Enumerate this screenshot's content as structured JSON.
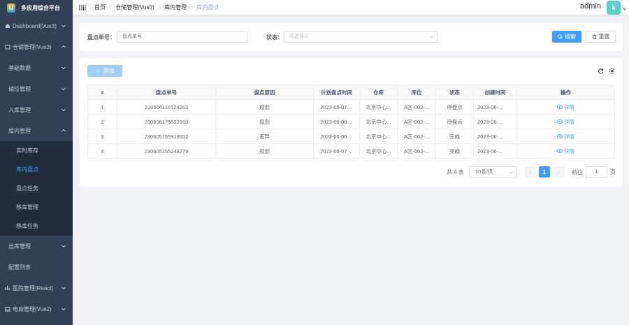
{
  "app": {
    "title": "多应用综合平台",
    "logo_letter": "U"
  },
  "sidebar": {
    "items": [
      {
        "label": "Dashboard(Vue3)",
        "icon": "home-icon",
        "caret": "down"
      },
      {
        "label": "仓储管理(Vue3)",
        "icon": "box-icon",
        "caret": "up"
      },
      {
        "label": "基础数据",
        "caret": "down"
      },
      {
        "label": "储位管理",
        "caret": "down"
      },
      {
        "label": "入库管理",
        "caret": "down"
      },
      {
        "label": "库内管理",
        "caret": "up"
      },
      {
        "label": "实时库存"
      },
      {
        "label": "库内盘点"
      },
      {
        "label": "盘点任务"
      },
      {
        "label": "移库管理"
      },
      {
        "label": "移库任务"
      },
      {
        "label": "出库管理",
        "caret": "down"
      },
      {
        "label": "配置列表"
      },
      {
        "label": "医院管理(React)",
        "icon": "chart-icon",
        "caret": "down"
      },
      {
        "label": "电商管理(Vue2)",
        "icon": "laptop-icon",
        "caret": "down"
      }
    ]
  },
  "header": {
    "breadcrumb": [
      "首页",
      "仓储管理(Vue3)",
      "库内管理",
      "库内盘点"
    ],
    "user": "admin",
    "avatar_letter": "k"
  },
  "search": {
    "order_label": "盘点单号：",
    "order_placeholder": "盘点单号",
    "status_label": "状态：",
    "status_placeholder": "请选择区",
    "search_button": "搜索",
    "reset_button": "重置"
  },
  "toolbar": {
    "add_button": "添加"
  },
  "table": {
    "columns": [
      "#",
      "盘点单号",
      "盘点原因",
      "计划盘点时间",
      "仓库",
      "库位",
      "状态",
      "创建时间",
      "操作"
    ],
    "rows": [
      {
        "index": "1",
        "order_no": "230606110124263",
        "reason": "规划",
        "plan_time": "2023-06-07 ...",
        "warehouse": "北京中心...",
        "location": "A区-002-...",
        "status": "待盘点",
        "created": "2023-06-...",
        "action": "详情"
      },
      {
        "index": "2",
        "order_no": "230606175532910",
        "reason": "规划",
        "plan_time": "2023-06-06 ...",
        "warehouse": "北京中心...",
        "location": "A区-002-...",
        "status": "待盘点",
        "created": "2023-06-...",
        "action": "详情"
      },
      {
        "index": "3",
        "order_no": "230605155919552",
        "reason": "差异",
        "plan_time": "2023-06-06 ...",
        "warehouse": "北京中心...",
        "location": "A区-002-...",
        "status": "完成",
        "created": "2023-06-...",
        "action": "详情"
      },
      {
        "index": "4",
        "order_no": "230605155248279",
        "reason": "规划",
        "plan_time": "2023-06-07 ...",
        "warehouse": "北京中心...",
        "location": "A区-002-...",
        "status": "完成",
        "created": "2023-06-...",
        "action": "详情"
      }
    ]
  },
  "pagination": {
    "total": "共 4 条",
    "page_size": "10条/页",
    "current_page": "1",
    "goto_label": "前往",
    "goto_value": "1",
    "page_unit": "页"
  },
  "colors": {
    "primary": "#409eff",
    "sidebar_bg": "#304156",
    "sidebar_active": "#409eff"
  }
}
